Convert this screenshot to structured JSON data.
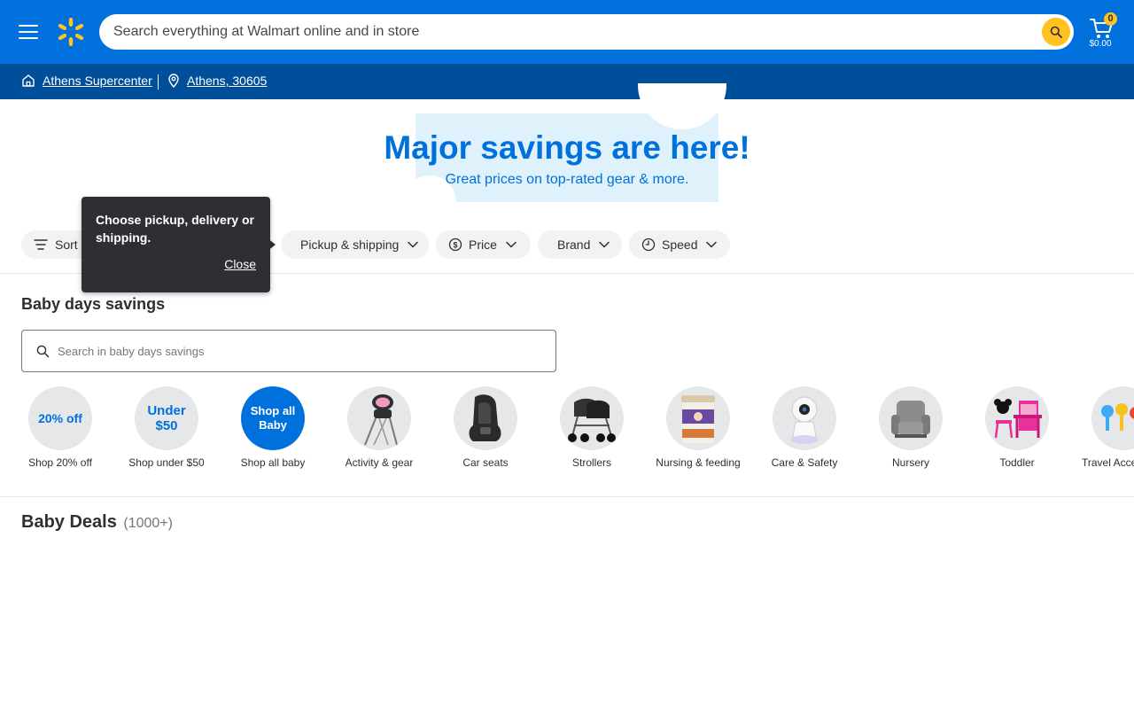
{
  "header": {
    "search_placeholder": "Search everything at Walmart online and in store",
    "cart_count": "0",
    "cart_total": "$0.00",
    "brand_color": "#0071dc",
    "accent_color": "#ffc220"
  },
  "subbar": {
    "store": "Athens Supercenter",
    "location": "Athens, 30605"
  },
  "banner": {
    "title": "Major savings are here!",
    "subtitle": "Great prices on top-rated gear & more."
  },
  "filters": {
    "sort": "Sort",
    "pickup": "Pickup & shipping",
    "price": "Price",
    "brand": "Brand",
    "speed": "Speed"
  },
  "tooltip": {
    "text": "Choose pickup, delivery or shipping.",
    "close": "Close"
  },
  "section": {
    "title": "Baby days savings",
    "search_placeholder": "Search in baby days savings"
  },
  "categories": [
    {
      "circle_text": "20% off",
      "label": "Shop 20% off",
      "icon": "percent-badge"
    },
    {
      "circle_text": "Under $50",
      "label": "Shop under $50",
      "icon": "price-badge"
    },
    {
      "circle_text": "Shop all Baby",
      "label": "Shop all baby",
      "icon": "all-baby-badge"
    },
    {
      "label": "Activity & gear",
      "icon": "high-chair-icon"
    },
    {
      "label": "Car seats",
      "icon": "car-seat-icon"
    },
    {
      "label": "Strollers",
      "icon": "stroller-icon"
    },
    {
      "label": "Nursing & feeding",
      "icon": "formula-can-icon"
    },
    {
      "label": "Care & Safety",
      "icon": "baby-monitor-icon"
    },
    {
      "label": "Nursery",
      "icon": "armchair-icon"
    },
    {
      "label": "Toddler",
      "icon": "toddler-desk-icon"
    },
    {
      "label": "Travel Accessories",
      "icon": "toys-icon"
    }
  ],
  "deals": {
    "title": "Baby Deals",
    "count": "(1000+)"
  }
}
